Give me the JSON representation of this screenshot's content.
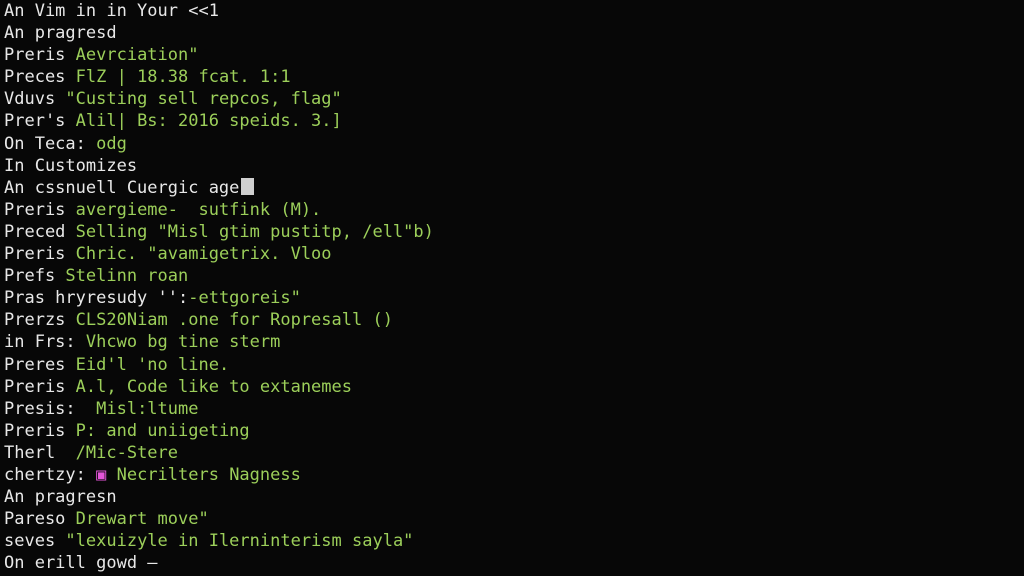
{
  "colors": {
    "background": "#070707",
    "prompt_text": "#e8e8e8",
    "output_text": "#9ccf5a",
    "icon_magenta": "#e455d8"
  },
  "lines": [
    {
      "a": "An Vim in in Your <<1",
      "b": ""
    },
    {
      "a": "An pragresd",
      "b": ""
    },
    {
      "a": "Preris ",
      "b": "Aevrciation\""
    },
    {
      "a": "Preces ",
      "b": "FlZ | 18.38 fcat. 1:1"
    },
    {
      "a": "Vduvs ",
      "b": "\"Custing sell repcos, flag\""
    },
    {
      "a": "Prer's ",
      "b": "Alil| Bs: 2016 speids. 3.]"
    },
    {
      "a": "On Teca: ",
      "b": "odg"
    },
    {
      "a": "In Customizes",
      "b": ""
    },
    {
      "a": "An cssnuell Cuergic age",
      "b": ""
    },
    {
      "a": "Preris ",
      "b": "avergieme-  sutfink (M)."
    },
    {
      "a": "Preced ",
      "b": "Selling \"Misl gtim pustitp, /ell\"b)"
    },
    {
      "a": "Preris ",
      "b": "Chric. \"avamigetrix. Vloo"
    },
    {
      "a": "Prefs ",
      "b": "Stelinn roan"
    },
    {
      "a": "Pras hryresudy '':",
      "b": "-ettgoreis\""
    },
    {
      "a": "Prerzs ",
      "b": "CLS20Niam .one for Ropresall ()"
    },
    {
      "a": "in Frs: ",
      "b": "Vhcwo bg tine sterm"
    },
    {
      "a": "Preres ",
      "b": "Eid'l 'no line."
    },
    {
      "a": "Preris ",
      "b": "A.l, Code like to extanemes"
    },
    {
      "a": "Presis:  ",
      "b": "Misl:ltume"
    },
    {
      "a": "Preris ",
      "b": "P: and uniigeting"
    },
    {
      "a": "Therl  ",
      "b": "/Mic-Stere"
    },
    {
      "a": "chertzy: ",
      "b": " Necrilters Nagness"
    },
    {
      "a": "An pragresn",
      "b": ""
    },
    {
      "a": "Pareso ",
      "b": "Drewart move\""
    },
    {
      "a": "seves ",
      "b": "\"lexuizyle in Ilerninterism sayla\""
    },
    {
      "a": "On erill gowd ",
      "b": "—"
    }
  ]
}
